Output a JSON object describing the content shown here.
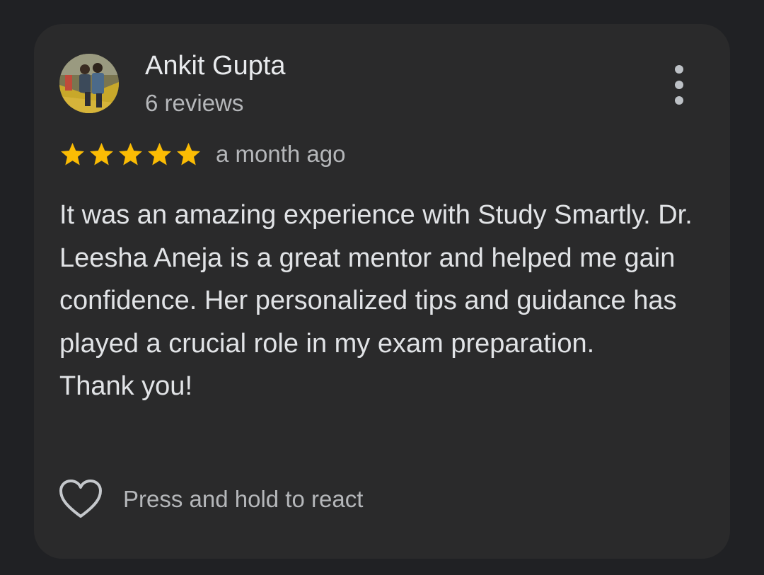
{
  "review": {
    "author_name": "Ankit Gupta",
    "author_reviews": "6 reviews",
    "avatar_icon": "profile-photo",
    "more_icon": "more-vert-icon",
    "rating": 5,
    "rating_max": 5,
    "time_ago": "a month ago",
    "text_lines": [
      "It was an amazing experience with Study Smartly. Dr. Leesha Aneja is a great mentor and helped me gain confidence. Her personalized tips and guidance has played a crucial role in my exam preparation.",
      "Thank you!"
    ],
    "react_label": "Press and hold to react",
    "react_icon": "heart-outline-icon"
  },
  "colors": {
    "background": "#202124",
    "card": "#2a2a2b",
    "star": "#fbbc04",
    "primary_text": "#e8eaed",
    "secondary_text": "#b5b7ba"
  }
}
